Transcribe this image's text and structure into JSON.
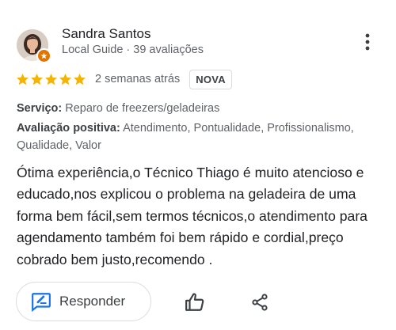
{
  "reviewer": {
    "name": "Sandra Santos",
    "meta": "Local Guide · 39 avaliações"
  },
  "rating": {
    "stars": 5,
    "max": 5,
    "time": "2 semanas atrás",
    "badge": "NOVA",
    "star_color": "#f4b400"
  },
  "attributes": {
    "service_label": "Serviço:",
    "service_value": "Reparo de freezers/geladeiras",
    "positive_label": "Avaliação positiva:",
    "positive_value": "Atendimento, Pontualidade, Profissionalismo, Qualidade, Valor"
  },
  "review_text": "Ótima experiência,o Técnico Thiago é muito atencioso e educado,nos explicou o problema na geladeira de uma forma bem fácil,sem termos técnicos,o atendimento para agendamento também foi bem rápido e cordial,preço cobrado bem justo,recomendo .",
  "actions": {
    "reply_label": "Responder",
    "reply_icon": "reply-edit-icon",
    "like_icon": "thumbs-up-icon",
    "share_icon": "share-icon"
  },
  "colors": {
    "accent_blue": "#1a73e8",
    "local_guide_orange": "#e37400"
  }
}
